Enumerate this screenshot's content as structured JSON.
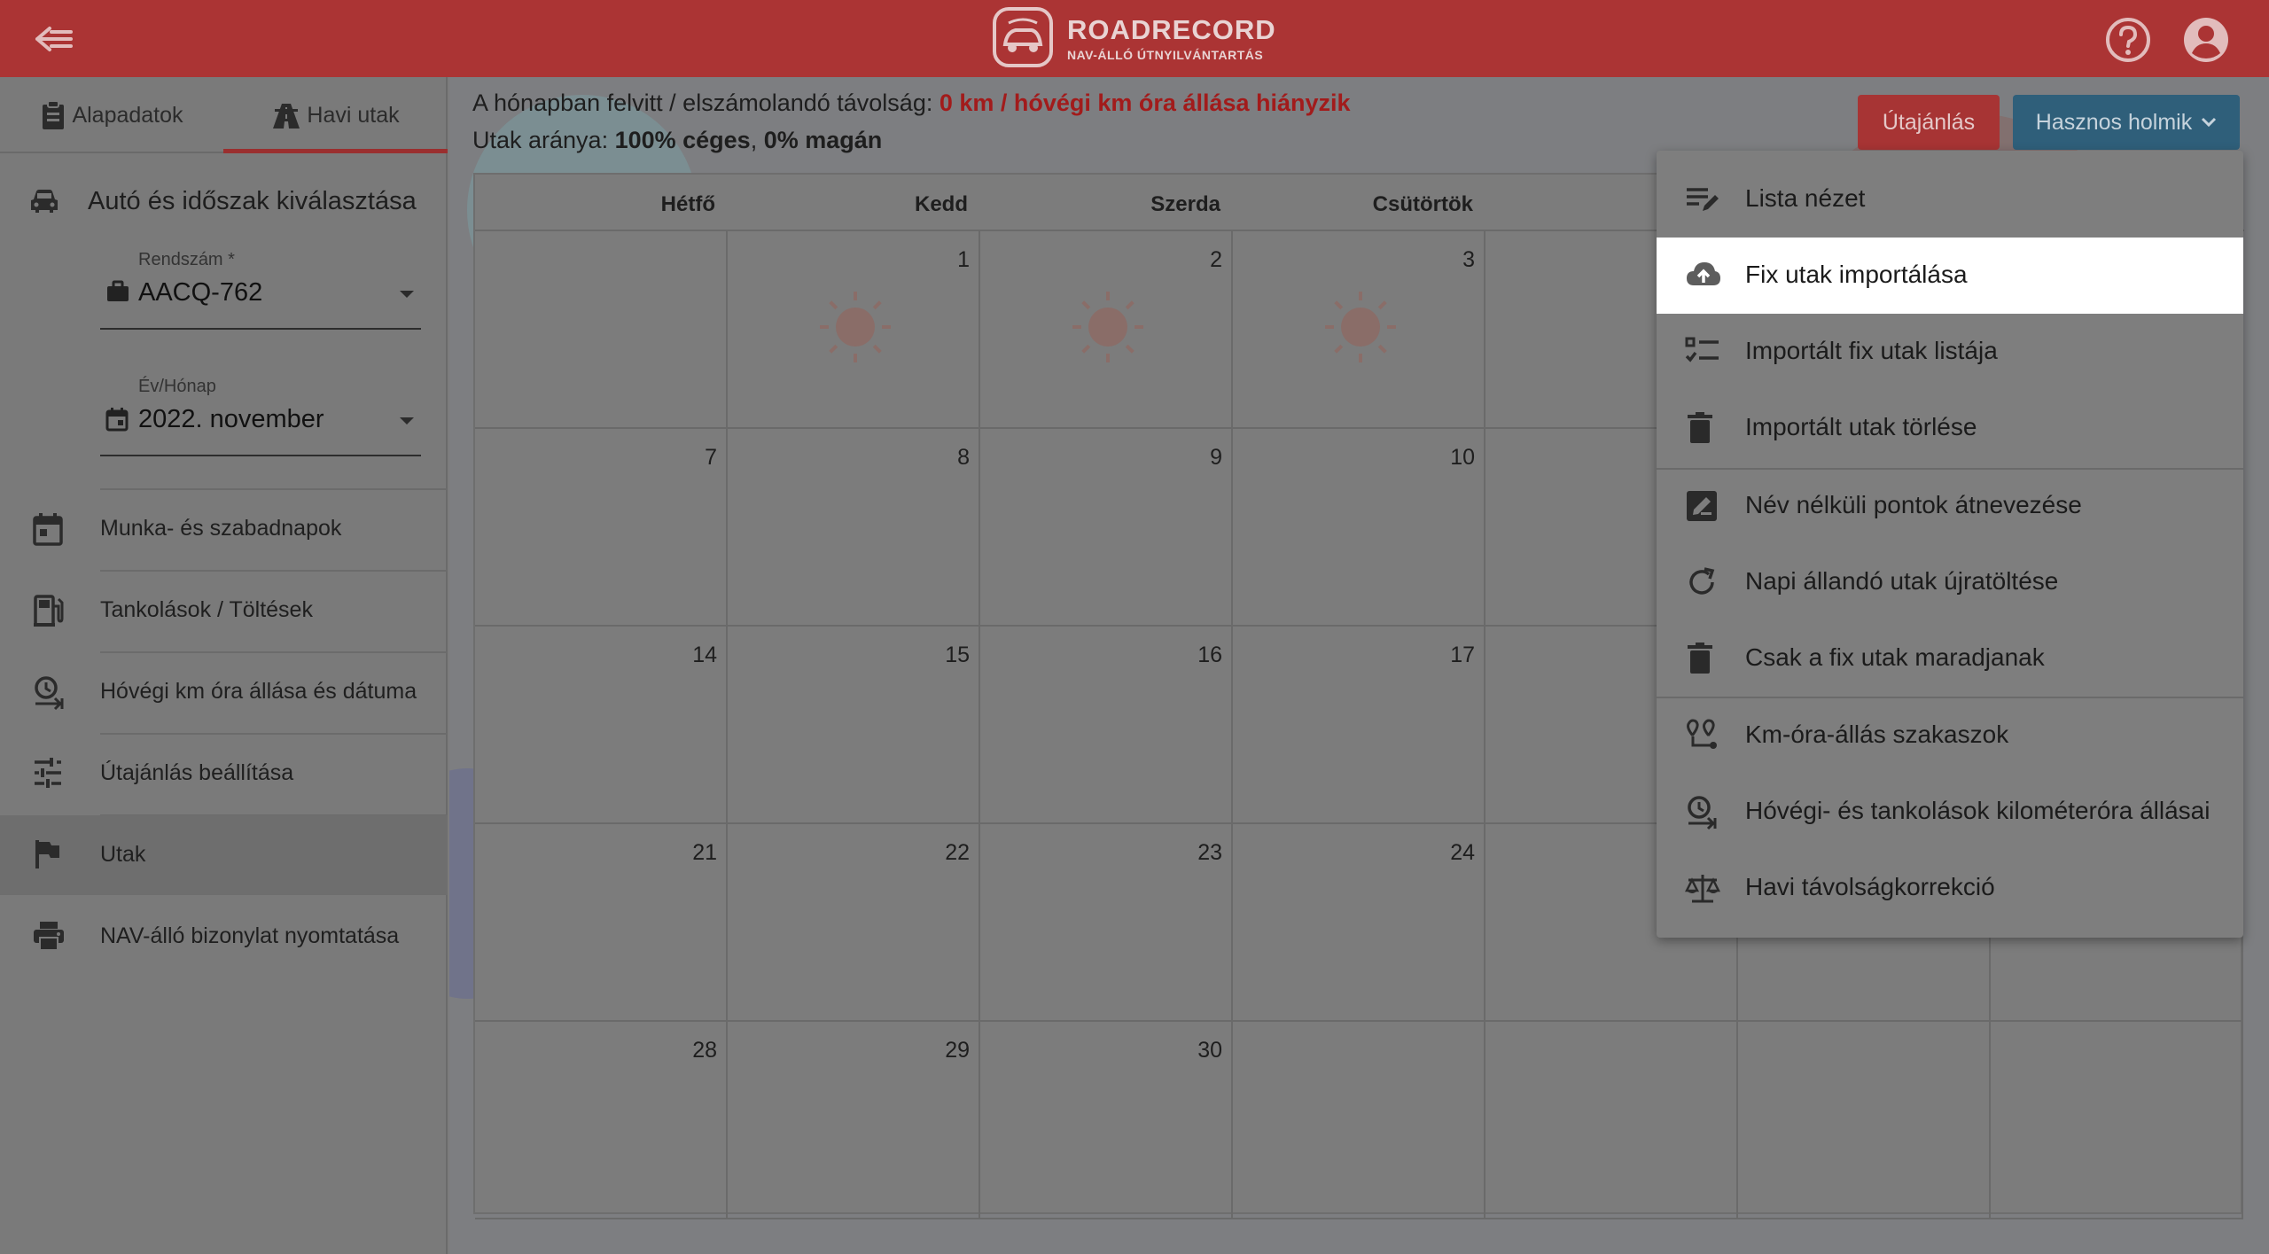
{
  "app": {
    "logo_title": "ROADRECORD",
    "logo_subtitle": "NAV-ÁLLÓ ÚTNYILVÁNTARTÁS"
  },
  "icons": {
    "back": "arrow-left-icon",
    "help": "help-circle-icon",
    "account": "account-circle-icon"
  },
  "sidebar": {
    "tabs": [
      {
        "label": "Alapadatok",
        "icon": "clipboard-icon"
      },
      {
        "label": "Havi utak",
        "icon": "road-icon"
      }
    ],
    "active_tab": "Havi utak",
    "section_title": "Autó és időszak kiválasztása",
    "plate_field": {
      "label": "Rendszám *",
      "value": "AACQ-762"
    },
    "period_field": {
      "label": "Év/Hónap",
      "value": "2022. november"
    },
    "items": [
      {
        "label": "Munka- és szabadnapok",
        "icon": "calendar-icon"
      },
      {
        "label": "Tankolások / Töltések",
        "icon": "fuel-icon"
      },
      {
        "label": "Hóvégi km óra állása és dátuma",
        "icon": "clock-arrow-icon"
      },
      {
        "label": "Útajánlás beállítása",
        "icon": "sliders-icon"
      },
      {
        "label": "Utak",
        "icon": "flag-icon"
      },
      {
        "label": "NAV-álló bizonylat nyomtatása",
        "icon": "printer-icon"
      }
    ]
  },
  "summary": {
    "distance_prefix": "A hónapban felvitt / elszámolandó távolság: ",
    "distance_value": "0 km / hóvégi km óra állása hiányzik",
    "ratio_prefix": "Utak aránya: ",
    "ratio_business": "100% céges",
    "ratio_sep": ", ",
    "ratio_private": "0% magán"
  },
  "toolbar": {
    "plan_label": "Útajánlás",
    "useful_label": "Hasznos holmik"
  },
  "calendar": {
    "weekdays": [
      "Hétfő",
      "Kedd",
      "Szerda",
      "Csütörtök"
    ],
    "weeks": [
      [
        "",
        "1",
        "2",
        "3",
        "",
        "",
        ""
      ],
      [
        "7",
        "8",
        "9",
        "10",
        "",
        "",
        ""
      ],
      [
        "14",
        "15",
        "16",
        "17",
        "",
        "",
        ""
      ],
      [
        "21",
        "22",
        "23",
        "24",
        "",
        "",
        ""
      ],
      [
        "28",
        "29",
        "30",
        "",
        "",
        "",
        ""
      ]
    ]
  },
  "dropdown": {
    "items": [
      {
        "label": "Lista nézet",
        "icon": "list-edit-icon"
      },
      {
        "label": "Fix utak importálása",
        "icon": "cloud-upload-icon"
      },
      {
        "label": "Importált fix utak listája",
        "icon": "checklist-icon"
      },
      {
        "label": "Importált utak törlése",
        "icon": "trash-icon"
      },
      {
        "label": "Név nélküli pontok átnevezése",
        "icon": "rename-icon"
      },
      {
        "label": "Napi állandó utak újratöltése",
        "icon": "reload-icon"
      },
      {
        "label": "Csak a fix utak maradjanak",
        "icon": "trash-icon"
      },
      {
        "label": "Km-óra-állás szakaszok",
        "icon": "route-pins-icon"
      },
      {
        "label": "Hóvégi- és tankolások kilométeróra állásai",
        "icon": "clock-arrow-icon"
      },
      {
        "label": "Havi távolságkorrekció",
        "icon": "scale-icon"
      }
    ],
    "highlighted": "Fix utak importálása"
  }
}
